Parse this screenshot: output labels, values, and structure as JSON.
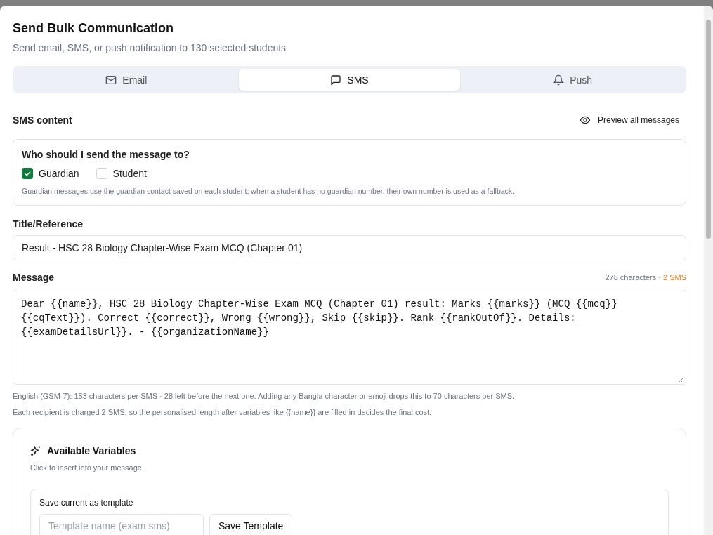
{
  "dialog": {
    "title": "Send Bulk Communication",
    "subtitle": "Send email, SMS, or push notification to 130 selected students"
  },
  "tabs": [
    {
      "label": "Email",
      "selected": false
    },
    {
      "label": "SMS",
      "selected": true
    },
    {
      "label": "Push",
      "selected": false
    }
  ],
  "sms_content": {
    "heading": "SMS content",
    "preview_button": "Preview all messages"
  },
  "recipients": {
    "question": "Who should I send the message to?",
    "options": [
      {
        "label": "Guardian",
        "checked": true
      },
      {
        "label": "Student",
        "checked": false
      }
    ],
    "note": "Guardian messages use the guardian contact saved on each student; when a student has no guardian number, their own number is used as a fallback."
  },
  "title_field": {
    "label": "Title/Reference",
    "value": "Result - HSC 28 Biology Chapter-Wise Exam MCQ (Chapter 01)"
  },
  "message": {
    "label": "Message",
    "char_count": "278 characters ·",
    "sms_count": "2 SMS",
    "value": "Dear {{name}}, HSC 28 Biology Chapter-Wise Exam MCQ (Chapter 01) result: Marks {{marks}} (MCQ {{mcq}} {{cqText}}). Correct {{correct}}, Wrong {{wrong}}, Skip {{skip}}. Rank {{rankOutOf}}. Details: {{examDetailsUrl}}. - {{organizationName}}",
    "hints": [
      "English (GSM-7): 153 characters per SMS · 28 left before the next one. Adding any Bangla character or emoji drops this to 70 characters per SMS.",
      "Each recipient is charged 2 SMS, so the personalised length after variables like {{name}} are filled in decides the final cost."
    ]
  },
  "variables": {
    "title": "Available Variables",
    "subtitle": "Click to insert into your message"
  },
  "template": {
    "label": "Save current as template",
    "placeholder": "Template name (exam sms)",
    "button": "Save Template"
  }
}
